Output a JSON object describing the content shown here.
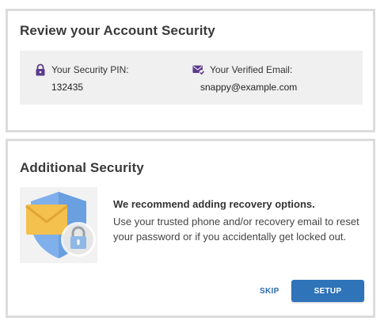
{
  "review": {
    "title": "Review your Account Security",
    "pin": {
      "icon": "lock-icon",
      "label": "Your Security PIN:",
      "value": "132435"
    },
    "email": {
      "icon": "verified-email-icon",
      "label": "Your Verified Email:",
      "value": "snappy@example.com"
    }
  },
  "additional": {
    "title": "Additional Security",
    "illustration": "shield-envelope-lock-icon",
    "recommend_title": "We recommend adding recovery options.",
    "recommend_body": "Use your trusted phone and/or recovery email to reset your password or if you accidentally get locked out.",
    "skip_label": "SKIP",
    "setup_label": "SETUP"
  },
  "colors": {
    "accent": "#2f73b8",
    "icon_purple": "#5b3a8c",
    "card_border": "#dcdcdc",
    "panel_bg": "#f0f0f0"
  }
}
